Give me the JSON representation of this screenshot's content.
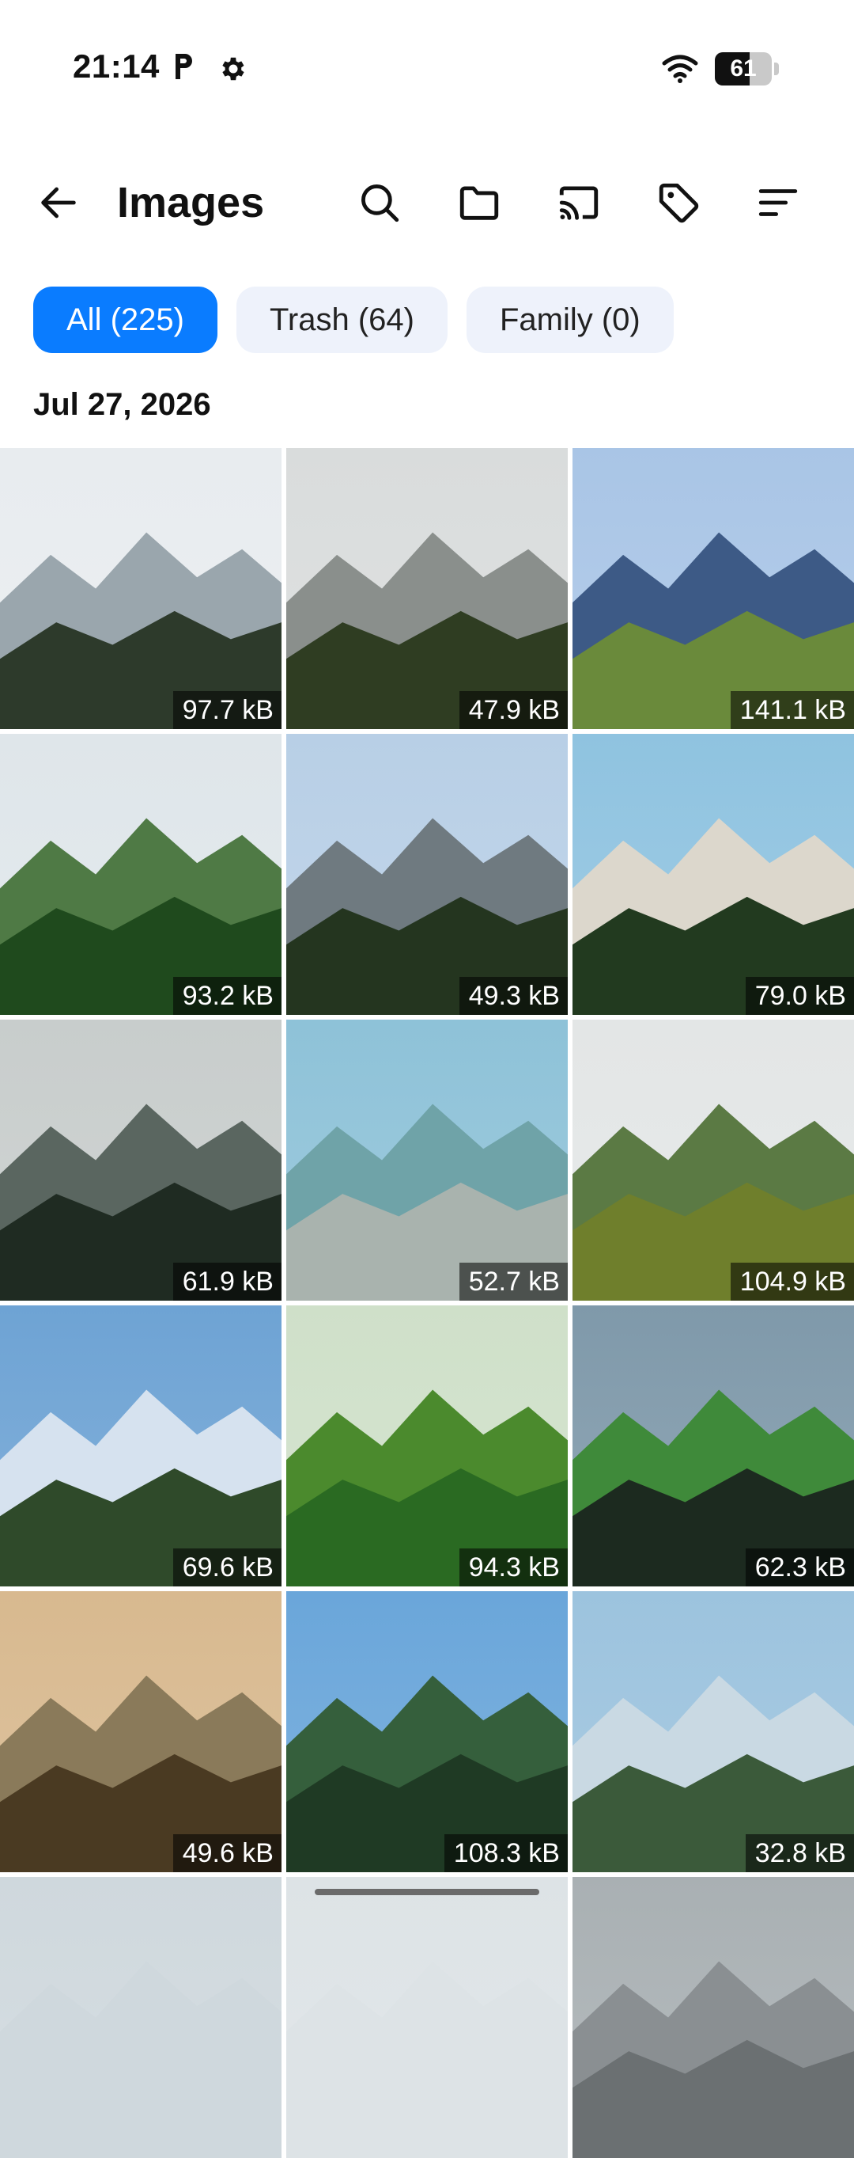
{
  "status_bar": {
    "time": "21:14",
    "battery_level": "61",
    "battery_fraction": 0.61,
    "icons": [
      "parking-icon",
      "gear-icon",
      "wifi-icon",
      "battery-icon"
    ]
  },
  "app_bar": {
    "title": "Images",
    "actions": [
      "back-arrow-icon",
      "search-icon",
      "folder-icon",
      "cast-icon",
      "tag-icon",
      "sort-icon"
    ]
  },
  "chips": [
    {
      "label": "All (225)",
      "active": true
    },
    {
      "label": "Trash (64)",
      "active": false
    },
    {
      "label": "Family (0)",
      "active": false
    }
  ],
  "date_header": "Jul 27, 2026",
  "images": [
    {
      "size": "97.7 kB",
      "sky": "#e8ecef",
      "mid": "#9aa6ad",
      "ground": "#2d3a2b"
    },
    {
      "size": "47.9 kB",
      "sky": "#d9dcdc",
      "mid": "#8a8f8c",
      "ground": "#2f3d22"
    },
    {
      "size": "141.1 kB",
      "sky": "#a9c5e6",
      "mid": "#3d5a86",
      "ground": "#6a8a3b"
    },
    {
      "size": "93.2 kB",
      "sky": "#dfe6ea",
      "mid": "#4f7a45",
      "ground": "#1f4a1d"
    },
    {
      "size": "49.3 kB",
      "sky": "#b8cfe6",
      "mid": "#6f7a80",
      "ground": "#24351f"
    },
    {
      "size": "79.0 kB",
      "sky": "#8fc3e0",
      "mid": "#dcd7cc",
      "ground": "#223a1f"
    },
    {
      "size": "61.9 kB",
      "sky": "#c8cdcc",
      "mid": "#5a6660",
      "ground": "#1f2b22"
    },
    {
      "size": "52.7 kB",
      "sky": "#8ec2d8",
      "mid": "#6fa3a8",
      "ground": "#a9b3ae"
    },
    {
      "size": "104.9 kB",
      "sky": "#e3e6e6",
      "mid": "#5b7a44",
      "ground": "#6f7f2c"
    },
    {
      "size": "69.6 kB",
      "sky": "#6ea3d4",
      "mid": "#d6e2ef",
      "ground": "#2f4a2a"
    },
    {
      "size": "94.3 kB",
      "sky": "#cfe0c9",
      "mid": "#4b8a2d",
      "ground": "#2a6a22"
    },
    {
      "size": "62.3 kB",
      "sky": "#7f99aa",
      "mid": "#3f8a3a",
      "ground": "#1c2a1f"
    },
    {
      "size": "49.6 kB",
      "sky": "#d8b98f",
      "mid": "#8a7a5a",
      "ground": "#4a3a22"
    },
    {
      "size": "108.3 kB",
      "sky": "#6aa6da",
      "mid": "#355f3c",
      "ground": "#1f3a24"
    },
    {
      "size": "32.8 kB",
      "sky": "#9cc3de",
      "mid": "#c9d9e3",
      "ground": "#3b5a3a"
    },
    {
      "size": "",
      "sky": "#cfd8dd",
      "mid": "#cfd8dd",
      "ground": "#cfd8dd"
    },
    {
      "size": "",
      "sky": "#dde3e6",
      "mid": "#dde3e6",
      "ground": "#dde3e6"
    },
    {
      "size": "",
      "sky": "#a9b0b3",
      "mid": "#8a8f92",
      "ground": "#6b7072"
    }
  ]
}
